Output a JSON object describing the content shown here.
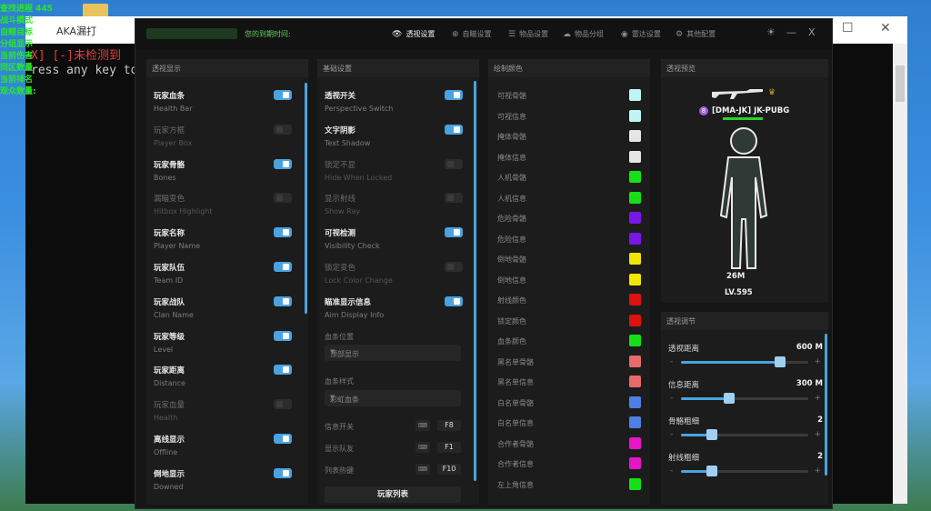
{
  "console": {
    "title": "AKA漏打",
    "line1_red": "X] [-]未检测到",
    "line2": "ress any key to"
  },
  "overlay": [
    "查找进程 445",
    "战斗模式",
    "自瞄目标",
    "分组显示",
    "当前伤害",
    "同区数量",
    "当前排名",
    "观众数量:"
  ],
  "app": {
    "expiry_label": "您的到期时间:",
    "nav": [
      {
        "icon": "eye-icon",
        "glyph": "👁",
        "label": "透视设置",
        "active": true
      },
      {
        "icon": "crosshair-icon",
        "glyph": "⊕",
        "label": "自瞄设置",
        "active": false
      },
      {
        "icon": "sliders-icon",
        "glyph": "☰",
        "label": "物品设置",
        "active": false
      },
      {
        "icon": "cloud-icon",
        "glyph": "☁",
        "label": "物品分组",
        "active": false
      },
      {
        "icon": "radar-icon",
        "glyph": "◉",
        "label": "雷达设置",
        "active": false
      },
      {
        "icon": "gear-icon",
        "glyph": "⚙",
        "label": "其他配置",
        "active": false
      }
    ],
    "window_controls": {
      "theme": "☀",
      "minimize": "—",
      "close": "X"
    }
  },
  "esp_display": {
    "title": "透视显示",
    "items": [
      {
        "zh": "玩家血条",
        "en": "Health Bar",
        "on": true
      },
      {
        "zh": "玩家方框",
        "en": "Player Box",
        "on": false
      },
      {
        "zh": "玩家骨骼",
        "en": "Bones",
        "on": true
      },
      {
        "zh": "漏瞄变色",
        "en": "Hitbox Highlight",
        "on": false
      },
      {
        "zh": "玩家名称",
        "en": "Player Name",
        "on": true
      },
      {
        "zh": "玩家队伍",
        "en": "Team ID",
        "on": true
      },
      {
        "zh": "玩家战队",
        "en": "Clan Name",
        "on": true
      },
      {
        "zh": "玩家等级",
        "en": "Level",
        "on": true
      },
      {
        "zh": "玩家距离",
        "en": "Distance",
        "on": true
      },
      {
        "zh": "玩家血量",
        "en": "Health",
        "on": false
      },
      {
        "zh": "离线显示",
        "en": "Offline",
        "on": true
      },
      {
        "zh": "倒地显示",
        "en": "Downed",
        "on": true
      }
    ]
  },
  "basic": {
    "title": "基础设置",
    "items": [
      {
        "zh": "透视开关",
        "en": "Perspective Switch",
        "on": true
      },
      {
        "zh": "文字阴影",
        "en": "Text Shadow",
        "on": true
      },
      {
        "zh": "锁定不显",
        "en": "Hide When Locked",
        "on": false
      },
      {
        "zh": "显示射线",
        "en": "Show Ray",
        "on": false
      },
      {
        "zh": "可视检测",
        "en": "Visibility Check",
        "on": true
      },
      {
        "zh": "锁定变色",
        "en": "Lock Color Change",
        "on": false
      },
      {
        "zh": "瞄准显示信息",
        "en": "Aim Display Info",
        "on": true
      }
    ],
    "health_pos_label": "血条位置",
    "health_pos_value": "顶部显示",
    "health_style_label": "血条样式",
    "health_style_value": "彩虹血条",
    "hotkeys": [
      {
        "label": "信息开关",
        "key": "F8"
      },
      {
        "label": "显示队友",
        "key": "F1"
      },
      {
        "label": "列表热键",
        "key": "F10"
      }
    ],
    "player_list_button": "玩家列表"
  },
  "colors": {
    "title": "绘制颜色",
    "items": [
      {
        "label": "可视骨骼",
        "color": "#bff5f5"
      },
      {
        "label": "可视信息",
        "color": "#bff5f5"
      },
      {
        "label": "掩体骨骼",
        "color": "#e6e6e6"
      },
      {
        "label": "掩体信息",
        "color": "#e6e6e6"
      },
      {
        "label": "人机骨骼",
        "color": "#16e016"
      },
      {
        "label": "人机信息",
        "color": "#16e016"
      },
      {
        "label": "危险骨骼",
        "color": "#7a16e6"
      },
      {
        "label": "危险信息",
        "color": "#7a16e6"
      },
      {
        "label": "倒地骨骼",
        "color": "#f2e600"
      },
      {
        "label": "倒地信息",
        "color": "#f2e600"
      },
      {
        "label": "射线颜色",
        "color": "#e01010"
      },
      {
        "label": "锁定颜色",
        "color": "#e01010"
      },
      {
        "label": "血条颜色",
        "color": "#16e016"
      },
      {
        "label": "黑名单骨骼",
        "color": "#e86a6a"
      },
      {
        "label": "黑名单信息",
        "color": "#e86a6a"
      },
      {
        "label": "白名单骨骼",
        "color": "#4f7fe6"
      },
      {
        "label": "白名单信息",
        "color": "#4f7fe6"
      },
      {
        "label": "合作者骨骼",
        "color": "#e616c8"
      },
      {
        "label": "合作者信息",
        "color": "#e616c8"
      },
      {
        "label": "左上角信息",
        "color": "#16e016"
      }
    ]
  },
  "preview": {
    "title": "透视预览",
    "team_badge": "8",
    "name": "[DMA-JK]  JK-PUBG",
    "distance": "26M",
    "level": "LV.595"
  },
  "tuning": {
    "title": "透视调节",
    "sliders": [
      {
        "label": "透视距离",
        "value": "600 M",
        "fraction": 0.78
      },
      {
        "label": "信息距离",
        "value": "300 M",
        "fraction": 0.38
      },
      {
        "label": "骨骼粗细",
        "value": "2",
        "fraction": 0.24
      },
      {
        "label": "射线粗细",
        "value": "2",
        "fraction": 0.24
      }
    ]
  },
  "accent": "#4aa3e0"
}
